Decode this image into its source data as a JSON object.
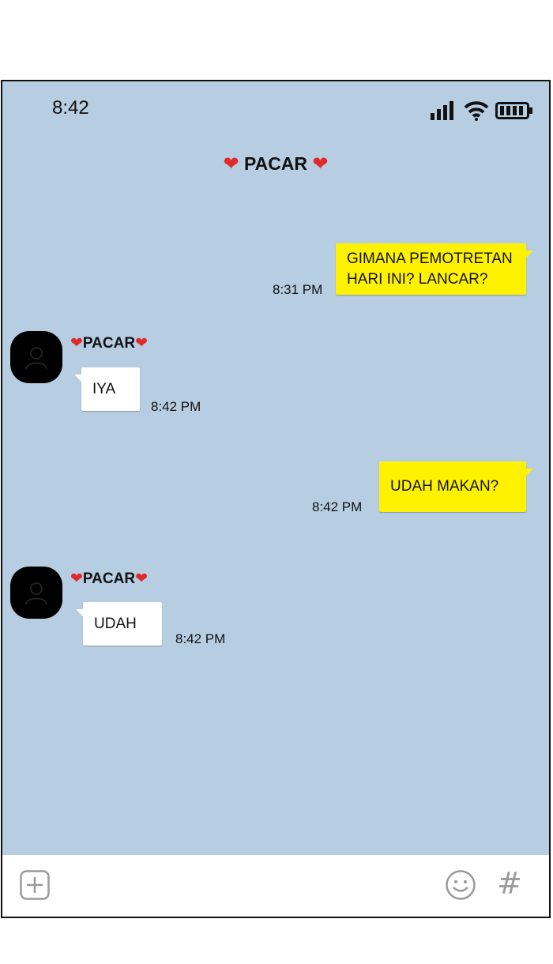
{
  "status_bar": {
    "time": "8:42",
    "signal_icon": "signal-bars-icon",
    "wifi_icon": "wifi-icon",
    "battery_icon": "battery-icon"
  },
  "header": {
    "heart": "❤",
    "title": "PACAR"
  },
  "messages": [
    {
      "direction": "out",
      "lines": [
        "GIMANA PEMOTRETAN",
        "HARI INI? LANCAR?"
      ],
      "time": "8:31 PM"
    },
    {
      "direction": "in",
      "sender": "PACAR",
      "text": "IYA",
      "time": "8:42 PM"
    },
    {
      "direction": "out",
      "lines": [
        "UDAH MAKAN?"
      ],
      "time": "8:42 PM"
    },
    {
      "direction": "in",
      "sender": "PACAR",
      "text": "UDAH",
      "time": "8:42 PM"
    }
  ],
  "input_bar": {
    "plus_icon": "plus-square-icon",
    "emoji_icon": "smiley-icon",
    "hash_label": "#"
  },
  "colors": {
    "background": "#b6cde2",
    "outgoing_bubble": "#fff200",
    "incoming_bubble": "#ffffff"
  }
}
